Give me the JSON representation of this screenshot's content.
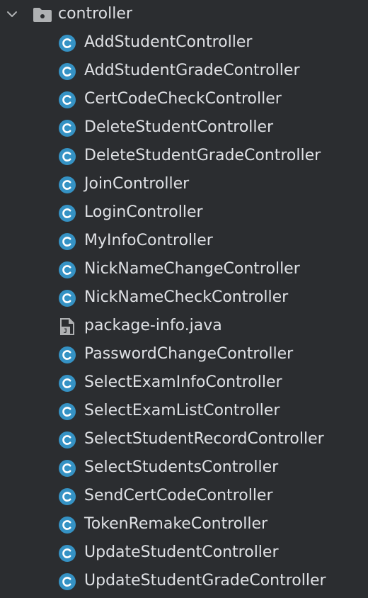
{
  "tree": {
    "folder": {
      "label": "controller",
      "expanded": true,
      "chevron_icon": "chevron-down-icon",
      "icon": "package-folder-icon"
    },
    "items": [
      {
        "label": "AddStudentController",
        "icon": "class-icon"
      },
      {
        "label": "AddStudentGradeController",
        "icon": "class-icon"
      },
      {
        "label": "CertCodeCheckController",
        "icon": "class-icon"
      },
      {
        "label": "DeleteStudentController",
        "icon": "class-icon"
      },
      {
        "label": "DeleteStudentGradeController",
        "icon": "class-icon"
      },
      {
        "label": "JoinController",
        "icon": "class-icon"
      },
      {
        "label": "LoginController",
        "icon": "class-icon"
      },
      {
        "label": "MyInfoController",
        "icon": "class-icon"
      },
      {
        "label": "NickNameChangeController",
        "icon": "class-icon"
      },
      {
        "label": "NickNameCheckController",
        "icon": "class-icon"
      },
      {
        "label": "package-info.java",
        "icon": "java-file-icon"
      },
      {
        "label": "PasswordChangeController",
        "icon": "class-icon"
      },
      {
        "label": "SelectExamInfoController",
        "icon": "class-icon"
      },
      {
        "label": "SelectExamListController",
        "icon": "class-icon"
      },
      {
        "label": "SelectStudentRecordController",
        "icon": "class-icon"
      },
      {
        "label": "SelectStudentsController",
        "icon": "class-icon"
      },
      {
        "label": "SendCertCodeController",
        "icon": "class-icon"
      },
      {
        "label": "TokenRemakeController",
        "icon": "class-icon"
      },
      {
        "label": "UpdateStudentController",
        "icon": "class-icon"
      },
      {
        "label": "UpdateStudentGradeController",
        "icon": "class-icon"
      }
    ]
  },
  "colors": {
    "background": "#2b2d30",
    "text": "#dfe1e5",
    "class_icon": "#3592c4",
    "class_letter": "#ffffff",
    "folder_icon": "#afb1b3",
    "chevron": "#afb1b3"
  }
}
